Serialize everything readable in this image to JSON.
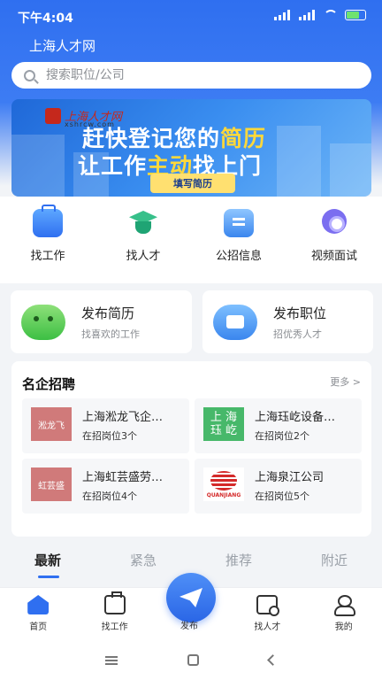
{
  "status_bar": {
    "time": "下午4:04"
  },
  "app": {
    "title": "上海人才网"
  },
  "search": {
    "placeholder": "搜索职位/公司"
  },
  "banner": {
    "logo_text": "上海人才网",
    "logo_url": "xshrcw.com",
    "line1_a": "赶快登记您的",
    "line1_b": "简历",
    "line2_a": "让工作",
    "line2_b": "主动",
    "line2_c": "找上门",
    "cta": "填写简历"
  },
  "quick_nav": [
    {
      "label": "找工作",
      "icon": "briefcase-icon"
    },
    {
      "label": "找人才",
      "icon": "graduation-cap-icon"
    },
    {
      "label": "公招信息",
      "icon": "document-icon"
    },
    {
      "label": "视频面试",
      "icon": "video-icon"
    }
  ],
  "publish": {
    "resume": {
      "title": "发布简历",
      "subtitle": "找喜欢的工作"
    },
    "job": {
      "title": "发布职位",
      "subtitle": "招优秀人才"
    }
  },
  "famous": {
    "title": "名企招聘",
    "more": "更多 >",
    "companies": [
      {
        "logo_text": "淞龙飞",
        "name": "上海淞龙飞企…",
        "count": "在招岗位3个"
      },
      {
        "logo_text_1": "上 海",
        "logo_text_2": "珏 屹",
        "name": "上海珏屹设备…",
        "count": "在招岗位2个"
      },
      {
        "logo_text": "虹芸盛",
        "name": "上海虹芸盛劳…",
        "count": "在招岗位4个"
      },
      {
        "logo_text": "QUANJIANG",
        "name": "上海泉江公司",
        "count": "在招岗位5个"
      }
    ]
  },
  "tabs": [
    "最新",
    "紧急",
    "推荐",
    "附近"
  ],
  "bottom_nav": {
    "home": "首页",
    "work": "找工作",
    "publish": "发布",
    "talent": "找人才",
    "mine": "我的"
  },
  "colors": {
    "primary": "#2f6ff0",
    "highlight": "#ffd83a"
  }
}
